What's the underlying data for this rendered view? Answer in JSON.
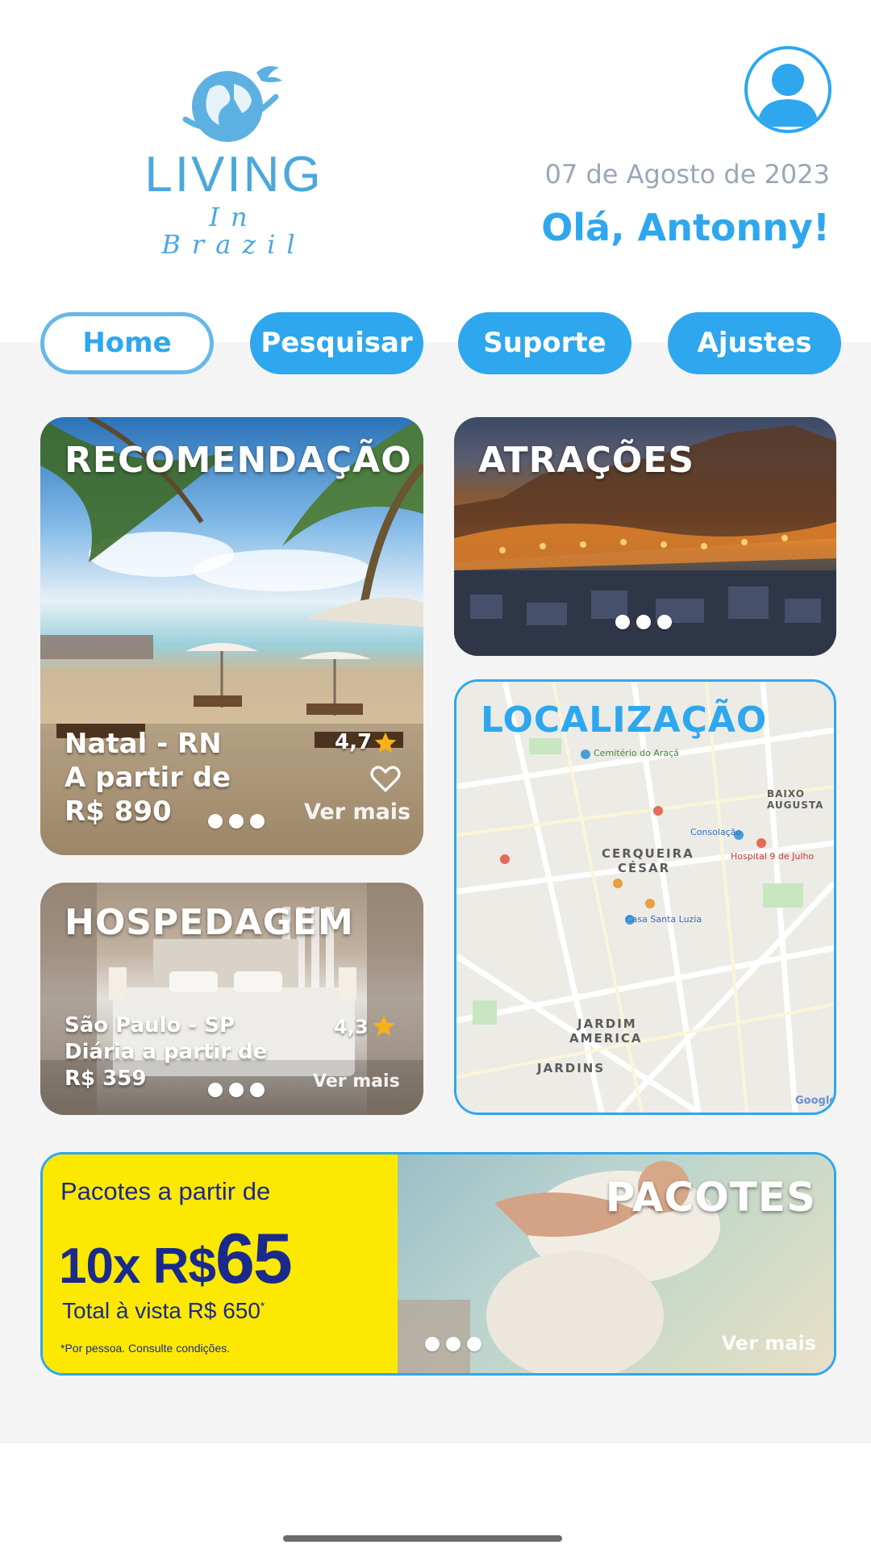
{
  "header": {
    "logo_title": "LIVING",
    "logo_subtitle": "In Brazil",
    "date": "07 de Agosto de 2023",
    "greeting": "Olá, Antonny!"
  },
  "nav": {
    "items": [
      {
        "label": "Home"
      },
      {
        "label": "Pesquisar"
      },
      {
        "label": "Suporte"
      },
      {
        "label": "Ajustes"
      }
    ]
  },
  "recommendation": {
    "title": "RECOMENDAÇÃO",
    "location": "Natal - RN",
    "price_prefix": "A partir de",
    "price": "R$ 890",
    "rating": "4,7",
    "ver_mais": "Ver mais"
  },
  "attractions": {
    "title": "ATRAÇÕES"
  },
  "location": {
    "title": "LOCALIZAÇÃO",
    "map_labels": {
      "cerqueira": "CERQUEIRA",
      "cesar": "CÉSAR",
      "jardim": "JARDIM",
      "america": "AMERICA",
      "jardins": "JARDINS",
      "bela_vista": "BAIXO AUGUSTA",
      "consolacao": "Consolação",
      "hospital": "Hospital 9 de Julho",
      "cemiterio": "Cemitério do Araçá",
      "casa_santa_luzia": "Casa Santa Luzia",
      "google": "Google"
    }
  },
  "lodging": {
    "title": "HOSPEDAGEM",
    "location": "São Paulo - SP",
    "price_prefix": "Diária a partir de",
    "price": "R$ 359",
    "rating": "4,3",
    "ver_mais": "Ver mais"
  },
  "packages": {
    "title": "PACOTES",
    "promo_line1": "Pacotes a partir de",
    "promo_installments": "10x R$",
    "promo_value": "65",
    "promo_total": "Total à vista R$ 650",
    "promo_total_mark": "*",
    "promo_note": "*Por pessoa. Consulte condições.",
    "ver_mais": "Ver mais"
  },
  "colors": {
    "accent": "#2ea7ee",
    "promo_yellow": "#fde801",
    "promo_navy": "#1a2a8c",
    "star": "#f5b21b"
  }
}
